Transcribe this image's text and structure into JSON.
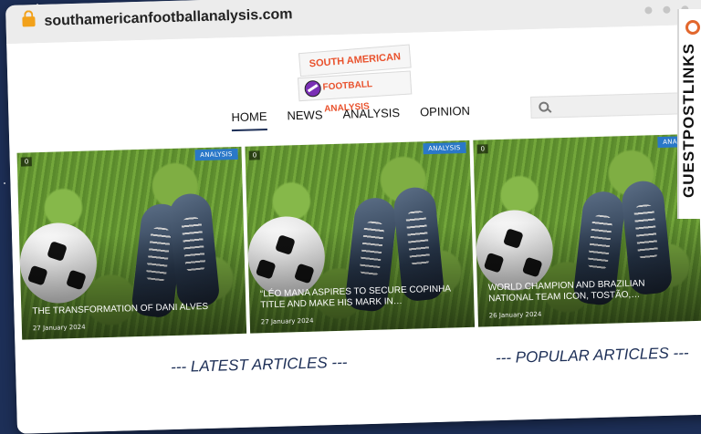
{
  "browser": {
    "url": "southamericanfootballanalysis.com"
  },
  "logo": {
    "line1": "SOUTH AMERICAN",
    "line2": "FOOTBALL ANALYSIS"
  },
  "nav": {
    "items": [
      {
        "label": "HOME",
        "active": true
      },
      {
        "label": "NEWS",
        "active": false
      },
      {
        "label": "ANALYSIS",
        "active": false
      },
      {
        "label": "OPINION",
        "active": false
      }
    ]
  },
  "search": {
    "placeholder": "",
    "icon": "search-icon"
  },
  "articles": [
    {
      "comments": "0",
      "category": "ANALYSIS",
      "title": "THE TRANSFORMATION OF DANI ALVES",
      "date": "27 January 2024"
    },
    {
      "comments": "0",
      "category": "ANALYSIS",
      "title": "“LÉO MANA ASPIRES TO SECURE COPINHA TITLE AND MAKE HIS MARK IN…",
      "date": "27 January 2024"
    },
    {
      "comments": "0",
      "category": "ANALYS",
      "title": "WORLD CHAMPION AND BRAZILIAN NATIONAL TEAM ICON, TOSTÃO,…",
      "date": "26 January 2024"
    }
  ],
  "sections": {
    "latest": "--- LATEST ARTICLES ---",
    "popular": "--- POPULAR ARTICLES ---"
  },
  "sidebar": {
    "text": "GUESTPOSTLINKS"
  },
  "colors": {
    "background": "#1d2f57",
    "accent": "#2a78c8",
    "brand": "#e9522d"
  }
}
